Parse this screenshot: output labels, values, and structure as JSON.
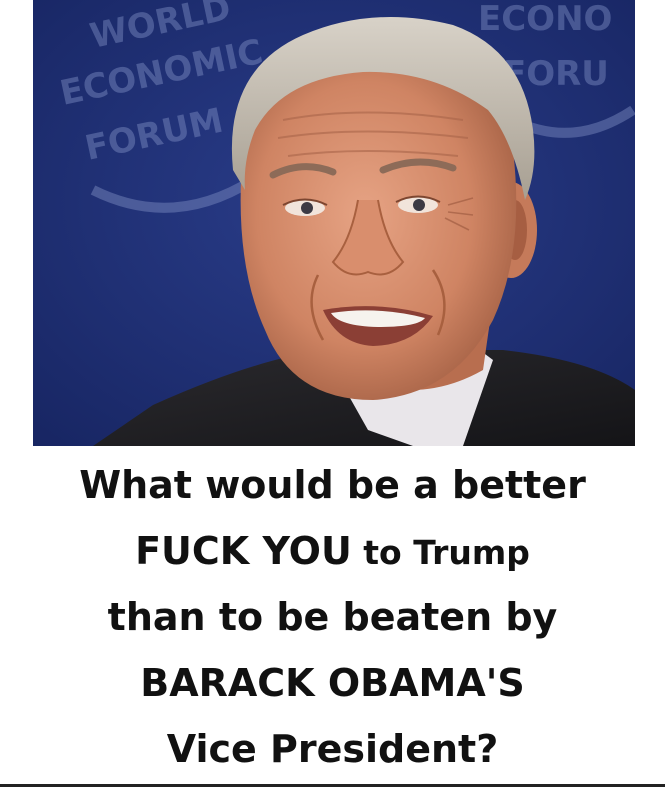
{
  "photo": {
    "background_color": "#1f2f73",
    "logo_left_text": [
      "WORLD",
      "ECONOMIC",
      "FORUM"
    ],
    "logo_right_text": [
      "ECONO",
      "FORU"
    ]
  },
  "caption": {
    "line1": "What would be a better",
    "line2_strong": "FUCK YOU",
    "line2_rest": " to Trump",
    "line3": "than to be beaten by",
    "line4": "BARACK OBAMA'S",
    "line5": "Vice President?"
  }
}
